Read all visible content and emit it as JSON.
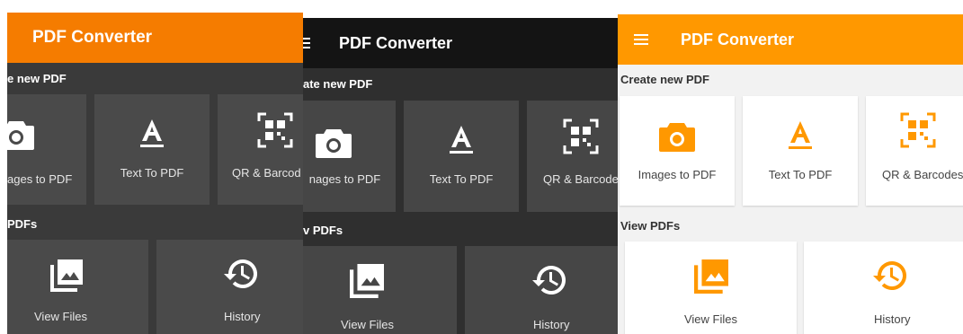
{
  "colors": {
    "accent_dark": "#f57c00",
    "accent_light": "#ff9800",
    "dark_bar": "#141414"
  },
  "panel1": {
    "title": "PDF Converter",
    "section_create": "e new PDF",
    "section_view": "PDFs",
    "cards": {
      "images": "ages to PDF",
      "text": "Text To PDF",
      "qr": "QR & Barcod",
      "files": "View Files",
      "history": "History"
    }
  },
  "panel2": {
    "title": "PDF Converter",
    "section_create": "ate new PDF",
    "section_view": "v PDFs",
    "cards": {
      "images": "nages to PDF",
      "text": "Text To PDF",
      "qr": "QR & Barcode",
      "files": "View Files",
      "history": "History"
    }
  },
  "panel3": {
    "title": "PDF Converter",
    "section_create": "Create new PDF",
    "section_view": "View PDFs",
    "cards": {
      "images": "Images to PDF",
      "text": "Text To PDF",
      "qr": "QR & Barcodes",
      "files": "View Files",
      "history": "History"
    }
  }
}
